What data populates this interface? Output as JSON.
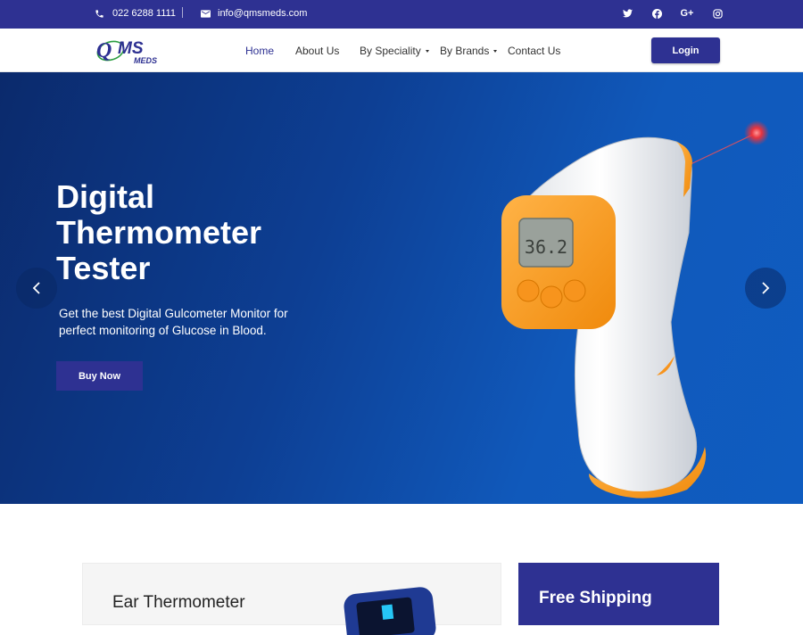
{
  "topbar": {
    "phone": "022 6288 1111",
    "email": "info@qmsmeds.com",
    "social": [
      {
        "icon": "twitter-icon",
        "glyph": "🐦"
      },
      {
        "icon": "facebook-icon",
        "glyph": "f"
      },
      {
        "icon": "google-plus-icon",
        "glyph": "G+"
      },
      {
        "icon": "instagram-icon",
        "glyph": "◎"
      }
    ]
  },
  "brand": {
    "logo_main": "QMS",
    "logo_sub": "MEDS"
  },
  "nav": {
    "home": "Home",
    "about": "About Us",
    "speciality": "By Speciality",
    "brands": "By Brands",
    "contact": "Contact Us",
    "login": "Login"
  },
  "hero": {
    "title": "Digital Thermometer Tester",
    "subtitle": "Get the best Digital Gulcometer Monitor for perfect monitoring of Glucose in Blood.",
    "cta": "Buy Now",
    "reading": "36.2",
    "prev": "‹",
    "next": "›"
  },
  "features": {
    "card_title": "Ear Thermometer",
    "shipping_title": "Free Shipping"
  },
  "colors": {
    "brand": "#2e3192",
    "accent": "#f7941d",
    "hero_dark": "#0b2a6c",
    "hero_light": "#0f5cc0"
  }
}
